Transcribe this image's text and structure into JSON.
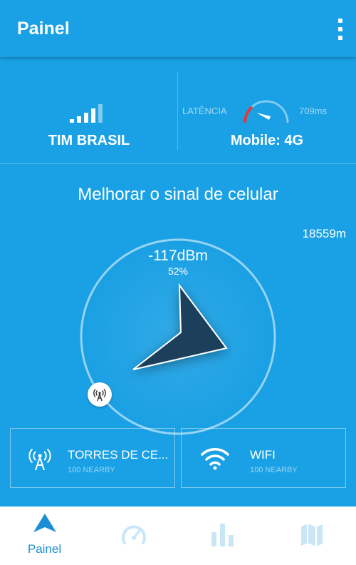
{
  "appbar": {
    "title": "Painel"
  },
  "carrier": {
    "name": "TIM BRASIL",
    "icon": "signal-bars-icon"
  },
  "latency": {
    "label": "LATÊNCIA",
    "value": "709ms",
    "network": "Mobile: 4G"
  },
  "headline": "Melhorar o sinal de celular",
  "distance": "18559m",
  "signal": {
    "dbm": "-117dBm",
    "percent": "52%"
  },
  "cards": {
    "towers": {
      "title": "TORRES DE CE...",
      "subtitle": "100 NEARBY",
      "icon": "cell-tower-icon"
    },
    "wifi": {
      "title": "WIFI",
      "subtitle": "100 NEARBY",
      "icon": "wifi-icon"
    }
  },
  "nav": {
    "items": [
      {
        "label": "Painel",
        "icon": "navigation-arrow-icon",
        "active": true
      },
      {
        "label": "",
        "icon": "speedometer-icon",
        "active": false
      },
      {
        "label": "",
        "icon": "bar-chart-icon",
        "active": false
      },
      {
        "label": "",
        "icon": "map-icon",
        "active": false
      }
    ]
  },
  "colors": {
    "background": "#1aa0e4",
    "accent": "#1a8fd6",
    "inactive": "#c9e6f7",
    "gauge_red": "#e53935",
    "pointer_dark": "#1b3f5c"
  }
}
